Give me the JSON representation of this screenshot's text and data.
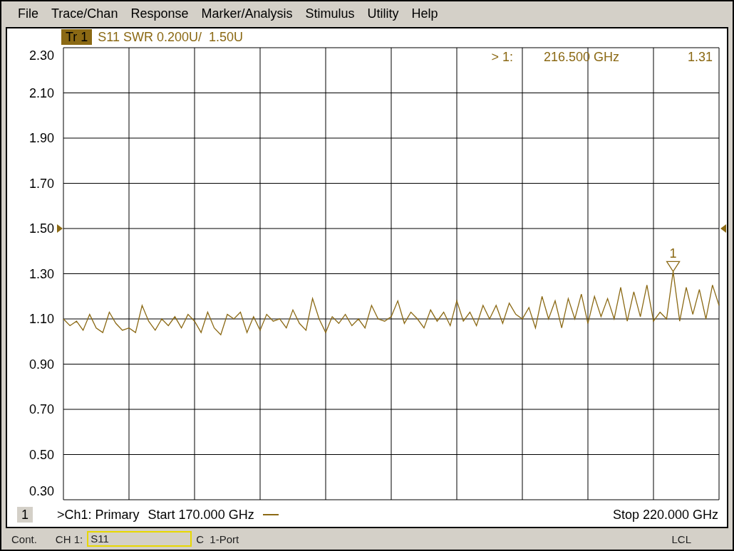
{
  "menu": [
    "File",
    "Trace/Chan",
    "Response",
    "Marker/Analysis",
    "Stimulus",
    "Utility",
    "Help"
  ],
  "trace": {
    "label": "Tr 1",
    "active": true,
    "scale": "S11 SWR 0.200U/  1.50U"
  },
  "marker_readout": {
    "marker": "> 1:",
    "stimulus": "216.500 GHz",
    "value": "1.31"
  },
  "marker": {
    "label": "1"
  },
  "chart_data": {
    "type": "line",
    "grid": true,
    "ylim": [
      0.3,
      2.3
    ],
    "yticks": [
      {
        "value": 2.3,
        "label": "2.30"
      },
      {
        "value": 2.1,
        "label": "2.10"
      },
      {
        "value": 1.9,
        "label": "1.90"
      },
      {
        "value": 1.7,
        "label": "1.70"
      },
      {
        "value": 1.5,
        "label": "1.50"
      },
      {
        "value": 1.3,
        "label": "1.30"
      },
      {
        "value": 1.1,
        "label": "1.10"
      },
      {
        "value": 0.9,
        "label": "0.90"
      },
      {
        "value": 0.7,
        "label": "0.70"
      },
      {
        "value": 0.5,
        "label": "0.50"
      },
      {
        "value": 0.3,
        "label": "0.30"
      }
    ],
    "categories": [
      null,
      null,
      null,
      null,
      null,
      null,
      null,
      null,
      null,
      null,
      null,
      null,
      null,
      null,
      null,
      null,
      null,
      null,
      null,
      null,
      null,
      null,
      null,
      null,
      null,
      null,
      null,
      null,
      null,
      null,
      null,
      null,
      null,
      null,
      null,
      null,
      null,
      null,
      null,
      null,
      null,
      null,
      null,
      null,
      null,
      null,
      null,
      null,
      null,
      null,
      null,
      null,
      null,
      null,
      null,
      null,
      null,
      null,
      null,
      null,
      null,
      null,
      null,
      null,
      null,
      null,
      null,
      null,
      null,
      null,
      null,
      null,
      null,
      null,
      null,
      null,
      null,
      null,
      null,
      null,
      null,
      null,
      null,
      null,
      null,
      null,
      null,
      null,
      null,
      null,
      null,
      null,
      null,
      null,
      null,
      null,
      null,
      null,
      null,
      null,
      null
    ],
    "series": [
      {
        "color": "#8b6914",
        "values": [
          1.1,
          1.07,
          1.09,
          1.05,
          1.12,
          1.06,
          1.04,
          1.13,
          1.08,
          1.05,
          1.06,
          1.04,
          1.16,
          1.09,
          1.05,
          1.1,
          1.07,
          1.11,
          1.06,
          1.12,
          1.09,
          1.04,
          1.13,
          1.06,
          1.03,
          1.12,
          1.1,
          1.13,
          1.04,
          1.11,
          1.05,
          1.12,
          1.09,
          1.1,
          1.06,
          1.14,
          1.08,
          1.05,
          1.19,
          1.1,
          1.04,
          1.11,
          1.08,
          1.12,
          1.07,
          1.1,
          1.06,
          1.16,
          1.1,
          1.09,
          1.11,
          1.18,
          1.08,
          1.13,
          1.1,
          1.06,
          1.14,
          1.09,
          1.13,
          1.07,
          1.18,
          1.09,
          1.13,
          1.07,
          1.16,
          1.1,
          1.16,
          1.08,
          1.17,
          1.12,
          1.1,
          1.15,
          1.06,
          1.2,
          1.1,
          1.18,
          1.06,
          1.19,
          1.1,
          1.21,
          1.08,
          1.2,
          1.11,
          1.19,
          1.1,
          1.24,
          1.09,
          1.22,
          1.11,
          1.25,
          1.09,
          1.13,
          1.1,
          1.31,
          1.09,
          1.24,
          1.12,
          1.23,
          1.1,
          1.25,
          1.16
        ]
      }
    ]
  },
  "channel_bar": {
    "number": "1",
    "title": ">Ch1: Primary",
    "start": "Start 170.000 GHz",
    "stop": "Stop 220.000 GHz"
  },
  "status_bar": {
    "mode": "Cont.",
    "channel": "CH 1:",
    "measurement": "S11",
    "calibration": "C  1-Port",
    "remote": "LCL"
  }
}
